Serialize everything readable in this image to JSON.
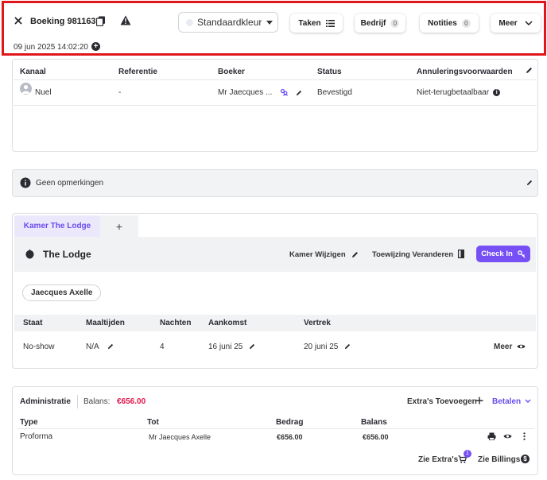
{
  "header": {
    "title": "Boeking 981163",
    "date": "09 jun 2025 14:02:20",
    "add_symbol": "+",
    "color_select": "Standaardkleur",
    "buttons": {
      "taken": "Taken",
      "bedrijf": "Bedrijf",
      "bedrijf_count": "0",
      "notities": "Notities",
      "notities_count": "0",
      "meer": "Meer"
    }
  },
  "booking_table": {
    "headers": [
      "Kanaal",
      "Referentie",
      "Boeker",
      "Status",
      "Annuleringsvoorwaarden"
    ],
    "row": {
      "kanaal": "Nuel",
      "referentie": "-",
      "boeker": "Mr Jaecques ...",
      "status": "Bevestigd",
      "annulering": "Niet-terugbetaalbaar"
    }
  },
  "remarks": {
    "text": "Geen opmerkingen"
  },
  "room": {
    "tab_label": "Kamer The Lodge",
    "tab_add": "+",
    "name": "The Lodge",
    "change_room": "Kamer Wijzigen",
    "change_assignment": "Toewijzing Veranderen",
    "checkin": "Check In",
    "guest": "Jaecques Axelle",
    "headers": [
      "Staat",
      "Maaltijden",
      "Nachten",
      "Aankomst",
      "Vertrek"
    ],
    "row": {
      "staat": "No-show",
      "maaltijden": "N/A",
      "nachten": "4",
      "aankomst": "16 juni 25",
      "vertrek": "20 juni 25",
      "meer": "Meer"
    }
  },
  "administration": {
    "title": "Administratie",
    "balance_label": "Balans:",
    "balance_value": "€656.00",
    "add_extras": "Extra's Toevoegen",
    "pay": "Betalen",
    "headers": [
      "Type",
      "Tot",
      "Bedrag",
      "Balans"
    ],
    "row": {
      "type": "Proforma",
      "tot": "Mr Jaecques Axelle",
      "bedrag": "€656.00",
      "balans": "€656.00"
    },
    "see_extras": "Zie Extra's",
    "extras_count": "1",
    "see_billings": "Zie Billings",
    "billings_symbol": "$"
  },
  "colors": {
    "accent": "#7650f4",
    "balance": "#e0144a",
    "highlight_border": "#e0161b"
  }
}
